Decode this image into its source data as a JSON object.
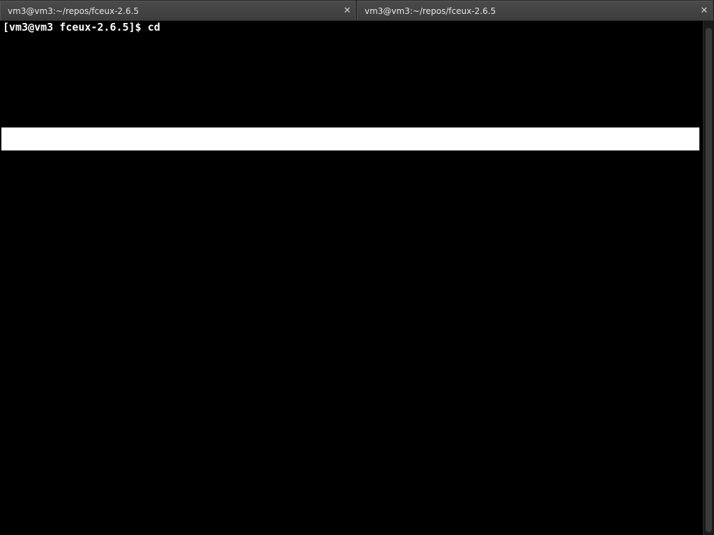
{
  "tabs": [
    {
      "label": "vm3@vm3:~/repos/fceux-2.6.5",
      "close": "✕"
    },
    {
      "label": "vm3@vm3:~/repos/fceux-2.6.5",
      "close": "✕"
    }
  ],
  "terminal": {
    "prompt": "[vm3@vm3 fceux-2.6.5]$ cd"
  },
  "colors": {
    "terminal_bg": "#000000",
    "terminal_fg": "#ffffff",
    "tab_bg": "#3f3f3f"
  }
}
